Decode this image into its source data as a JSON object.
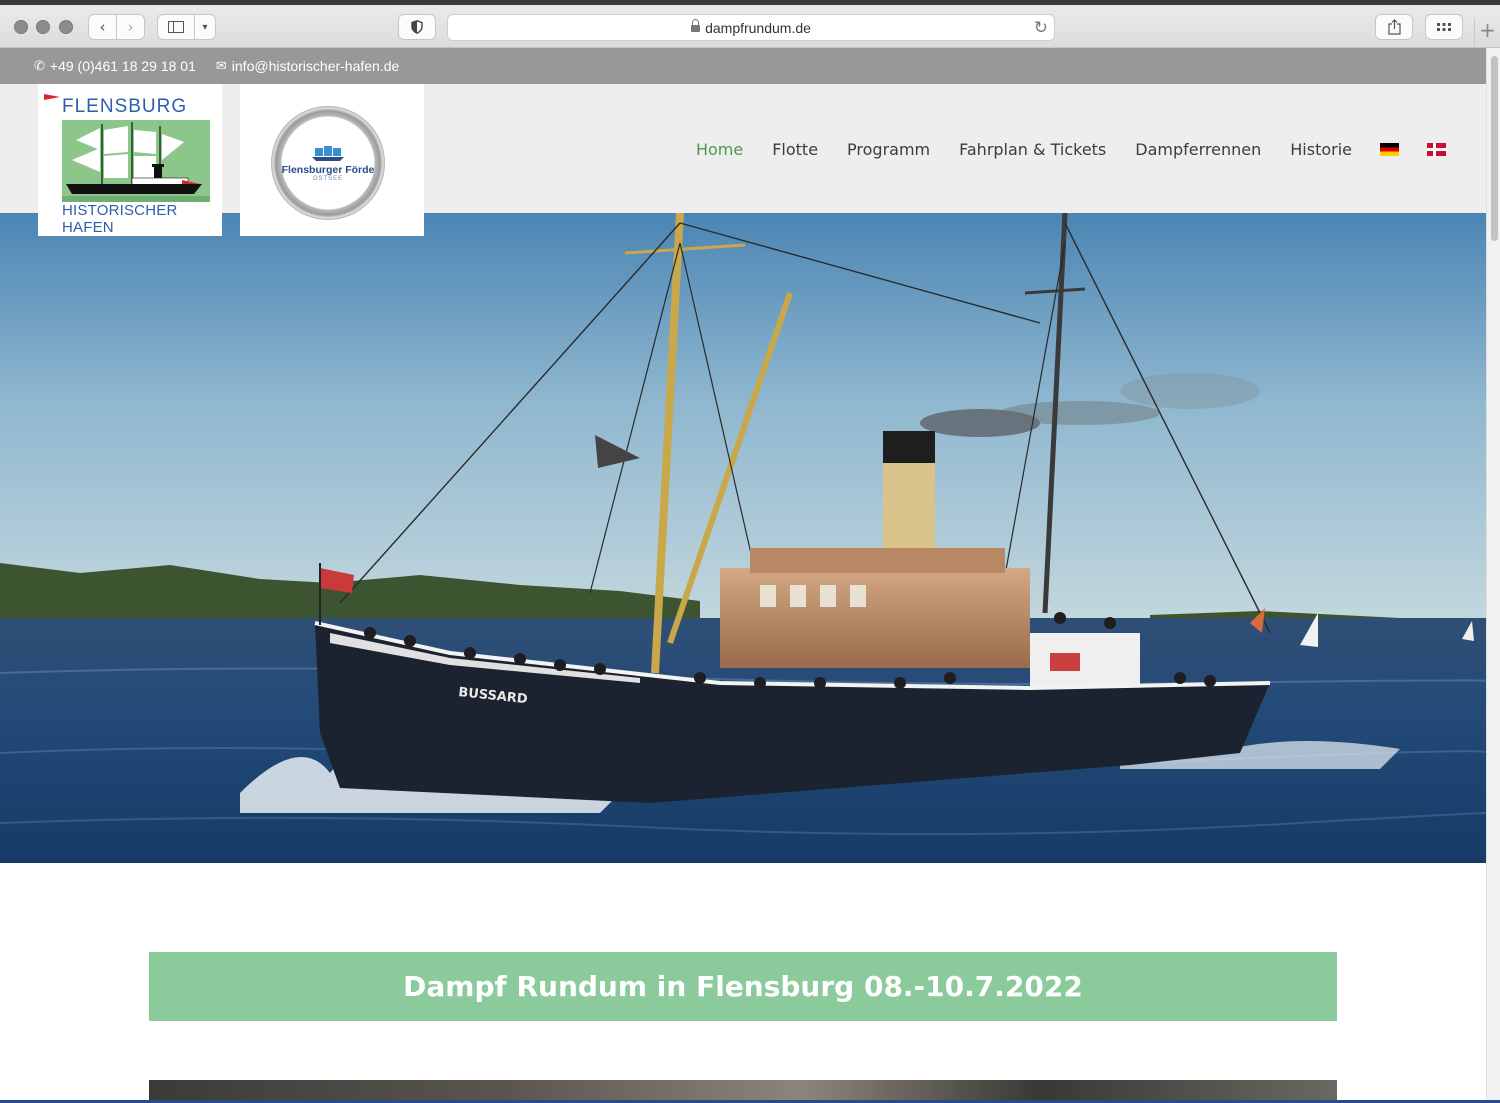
{
  "browser": {
    "url": "dampfrundum.de"
  },
  "topbar": {
    "phone": "+49 (0)461 18 29 18 01",
    "email": "info@historischer-hafen.de"
  },
  "logos": {
    "logo1_top": "FLENSBURG",
    "logo1_bottom": "HISTORISCHER HAFEN",
    "logo2_name": "Flensburger Förde",
    "logo2_sub": "OSTSEE"
  },
  "nav": {
    "items": [
      "Home",
      "Flotte",
      "Programm",
      "Fahrplan & Tickets",
      "Dampferrennen",
      "Historie"
    ],
    "active": "Home",
    "languages": [
      "de",
      "dk"
    ]
  },
  "hero": {
    "ship_name": "BUSSARD"
  },
  "banner": {
    "title": "Dampf Rundum in Flensburg 08.-10.7.2022"
  },
  "colors": {
    "accent_green": "#8bca9b",
    "active_nav": "#4a9a4a",
    "topbar_bg": "#989898"
  }
}
